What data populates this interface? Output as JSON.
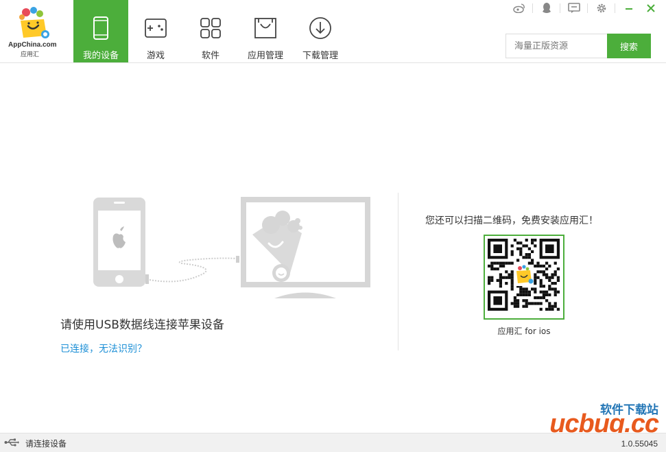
{
  "app": {
    "logo_text": "AppChina.com",
    "logo_sub": "应用汇"
  },
  "nav": {
    "items": [
      {
        "label": "我的设备",
        "icon": "phone-icon",
        "active": true
      },
      {
        "label": "游戏",
        "icon": "gamepad-icon",
        "active": false
      },
      {
        "label": "软件",
        "icon": "apps-grid-icon",
        "active": false
      },
      {
        "label": "应用管理",
        "icon": "bag-icon",
        "active": false
      },
      {
        "label": "下载管理",
        "icon": "download-icon",
        "active": false
      }
    ]
  },
  "window_controls": [
    "weibo-icon",
    "qq-icon",
    "message-icon",
    "gear-icon",
    "minimize-icon",
    "close-icon"
  ],
  "search": {
    "placeholder": "海量正版资源",
    "button_label": "搜索"
  },
  "main": {
    "hint": "请使用USB数据线连接苹果设备",
    "link": "已连接，无法识别？"
  },
  "qr": {
    "title": "您还可以扫描二维码，免费安装应用汇！",
    "caption": "应用汇 for ios"
  },
  "watermark": {
    "top": "软件下载站",
    "main": "ucbug.cc"
  },
  "status": {
    "text": "请连接设备",
    "version": "1.0.55045"
  },
  "colors": {
    "accent": "#4cae3b",
    "link": "#1c8fd6",
    "illustration_gray": "#d6d6d6"
  }
}
